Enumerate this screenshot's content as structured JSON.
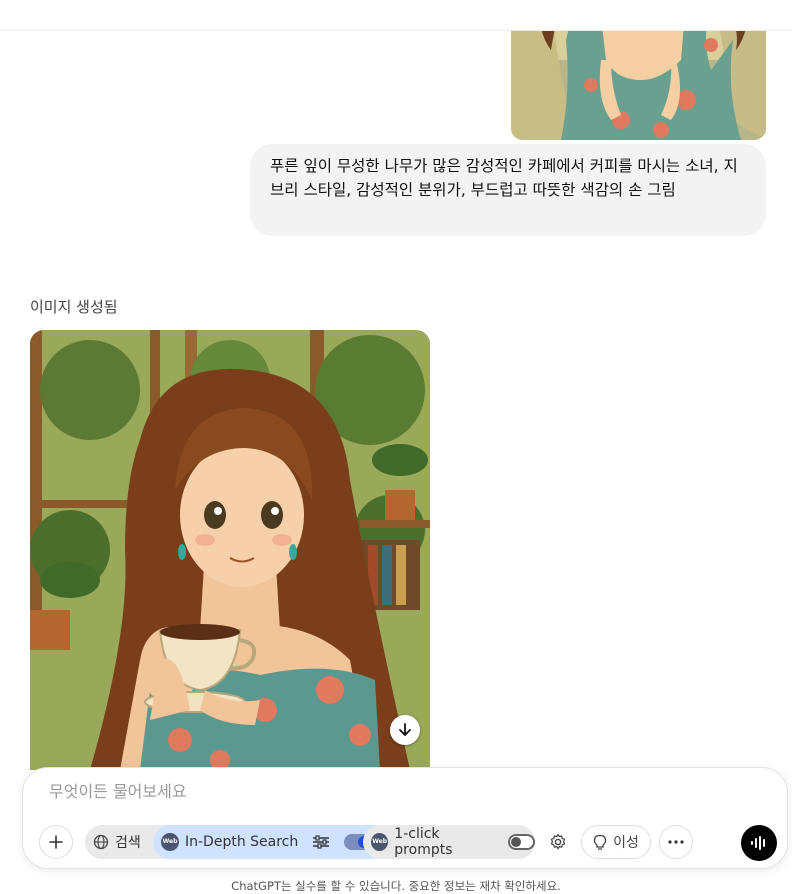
{
  "user_message": {
    "text": "푸른 잎이 무성한 나무가 많은 감성적인 카페에서 커피를 마시는 소녀, 지브리 스타일, 감성적인 분위가, 부드럽고 따뜻한 색감의 손 그림"
  },
  "assistant": {
    "image_label": "이미지 생성됨"
  },
  "composer": {
    "placeholder": "무엇이든 물어보세요",
    "value": "",
    "tools": {
      "search_label": "검색",
      "indepth_label": "In-Depth Search",
      "indepth_enabled": true,
      "prompts_label": "1-click prompts",
      "prompts_enabled": false,
      "reason_label": "이성",
      "web_badge_text": "Web"
    }
  },
  "footer": {
    "disclaimer": "ChatGPT는 실수를 할 수 있습니다. 중요한 정보는 재차 확인하세요."
  },
  "icons": [
    "plus-icon",
    "globe-icon",
    "sliders-icon",
    "gear-icon",
    "lightbulb-icon",
    "more-icon",
    "voice-icon",
    "download-icon"
  ],
  "colors": {
    "bubble_bg": "#f3f3f3",
    "indepth_bg": "#cfe2ff",
    "toggle_accent": "#1f4fd8",
    "voice_btn": "#000000"
  }
}
